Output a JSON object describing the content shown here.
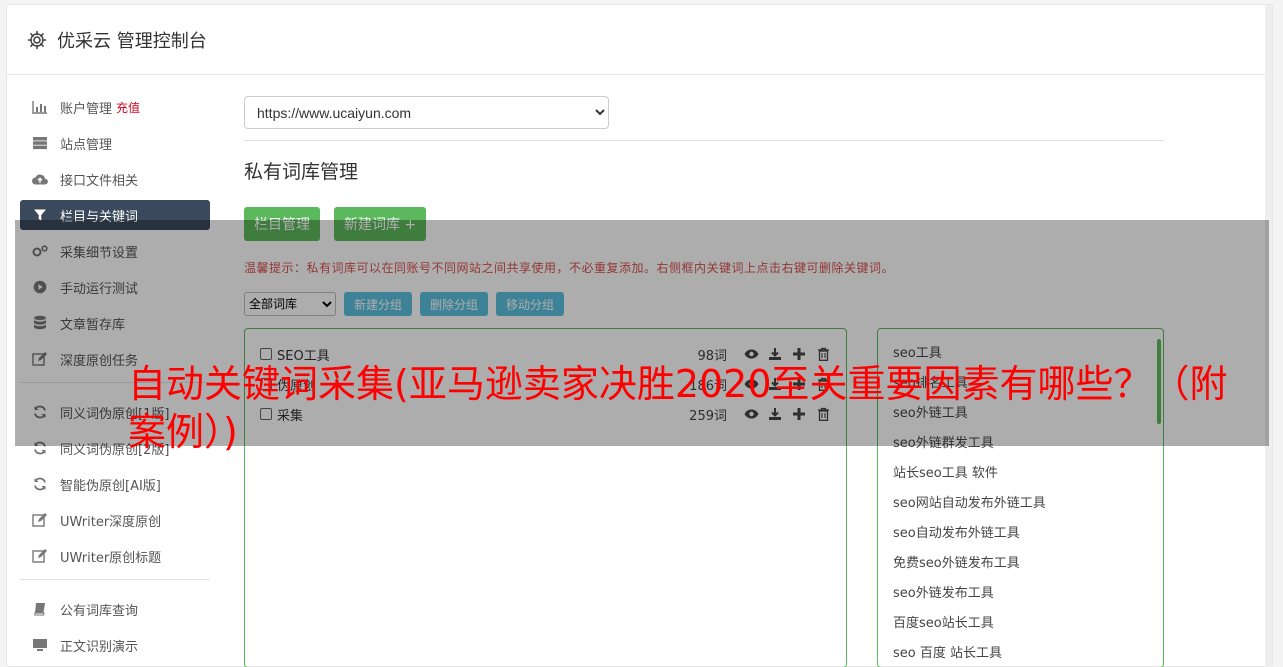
{
  "header": {
    "title": "优采云 管理控制台"
  },
  "sidebar": {
    "group1": [
      {
        "label": "账户管理",
        "badge": "充值",
        "icon": "bar-chart-icon"
      },
      {
        "label": "站点管理",
        "icon": "server-icon"
      },
      {
        "label": "接口文件相关",
        "icon": "cloud-upload-icon"
      },
      {
        "label": "栏目与关键词",
        "icon": "filter-icon",
        "active": true
      },
      {
        "label": "采集细节设置",
        "icon": "gears-icon"
      },
      {
        "label": "手动运行测试",
        "icon": "play-circle-icon"
      },
      {
        "label": "文章暂存库",
        "icon": "database-icon"
      },
      {
        "label": "深度原创任务",
        "icon": "edit-icon"
      }
    ],
    "group2": [
      {
        "label": "同义词伪原创[1版]",
        "icon": "refresh-icon"
      },
      {
        "label": "同义词伪原创[2版]",
        "icon": "refresh-icon"
      },
      {
        "label": "智能伪原创[AI版]",
        "icon": "refresh-icon"
      },
      {
        "label": "UWriter深度原创",
        "icon": "edit-icon"
      },
      {
        "label": "UWriter原创标题",
        "icon": "edit-icon"
      }
    ],
    "group3": [
      {
        "label": "公有词库查询",
        "icon": "book-icon"
      },
      {
        "label": "正文识别演示",
        "icon": "desktop-icon"
      }
    ]
  },
  "main": {
    "site_select": {
      "value": "https://www.ucaiyun.com"
    },
    "section_title": "私有词库管理",
    "buttons": {
      "column_manage": "栏目管理",
      "new_library": "新建词库 +"
    },
    "tip": "温馨提示：私有词库可以在同账号不同网站之间共享使用，不必重复添加。右侧框内关键词上点击右键可删除关键词。",
    "group_select": {
      "value": "全部词库"
    },
    "group_buttons": {
      "new_group": "新建分组",
      "delete_group": "删除分组",
      "move_group": "移动分组"
    },
    "libraries": [
      {
        "name": "SEO工具",
        "count": "98词"
      },
      {
        "name": "伪原创",
        "count": "186词"
      },
      {
        "name": "采集",
        "count": "259词"
      }
    ],
    "keywords": [
      "seo工具",
      "seo排名工具",
      "seo外链工具",
      "seo外链群发工具",
      "站长seo工具 软件",
      "seo网站自动发布外链工具",
      "seo自动发布外链工具",
      "免费seo外链发布工具",
      "seo外链发布工具",
      "百度seo站长工具",
      "seo 百度 站长工具"
    ]
  },
  "overlay": {
    "headline": "自动关键词采集(亚马逊卖家决胜2020至关重要因素有哪些？（附案例）)"
  },
  "colors": {
    "accent_green": "#5cb85c",
    "accent_blue": "#5bc0de",
    "tip_red": "#d9534f",
    "headline_red": "#ff0000",
    "active_nav": "#3a4a5c"
  }
}
